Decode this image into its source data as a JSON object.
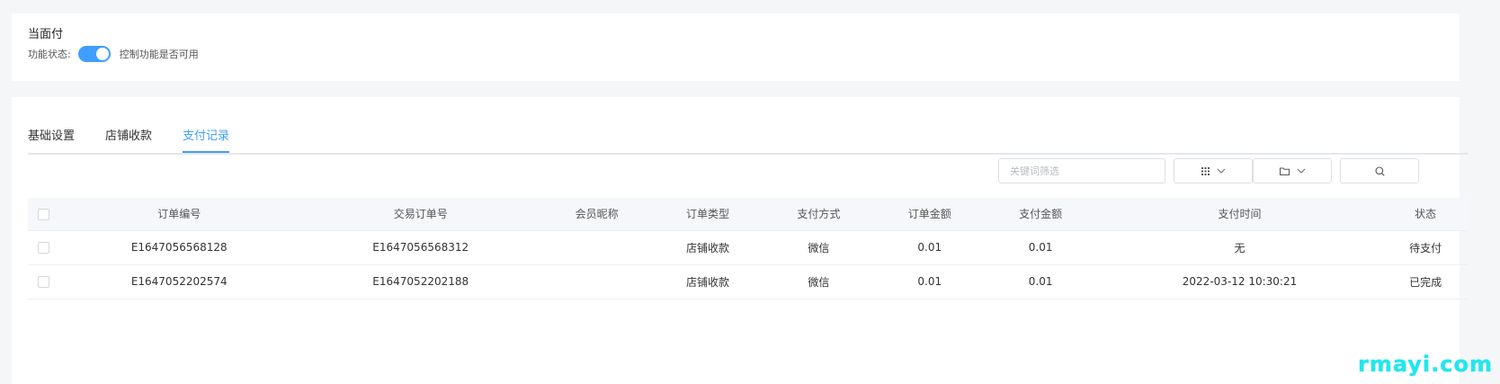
{
  "card1": {
    "title": "当面付",
    "status_label": "功能状态:",
    "toggle_on": true,
    "toggle_hint": "控制功能是否可用"
  },
  "tabs": [
    {
      "label": "基础设置",
      "active": false
    },
    {
      "label": "店铺收款",
      "active": false
    },
    {
      "label": "支付记录",
      "active": true
    }
  ],
  "filters": {
    "keyword_placeholder": "关键词筛选",
    "keyword_value": "",
    "select1_icon": "grid-icon",
    "select2_icon": "folder-icon",
    "search_icon": "search-icon"
  },
  "table": {
    "columns": [
      "订单编号",
      "交易订单号",
      "会员昵称",
      "订单类型",
      "支付方式",
      "订单金额",
      "支付金额",
      "支付时间",
      "状态"
    ],
    "rows": [
      [
        "E1647056568128",
        "E1647056568312",
        "",
        "店铺收款",
        "微信",
        "0.01",
        "0.01",
        "无",
        "待支付"
      ],
      [
        "E1647052202574",
        "E1647052202188",
        "",
        "店铺收款",
        "微信",
        "0.01",
        "0.01",
        "2022-03-12 10:30:21",
        "已完成"
      ]
    ]
  },
  "watermark": "rmayi.com",
  "colors": {
    "accent": "#409eff",
    "watermark": "#1fe8f0"
  }
}
